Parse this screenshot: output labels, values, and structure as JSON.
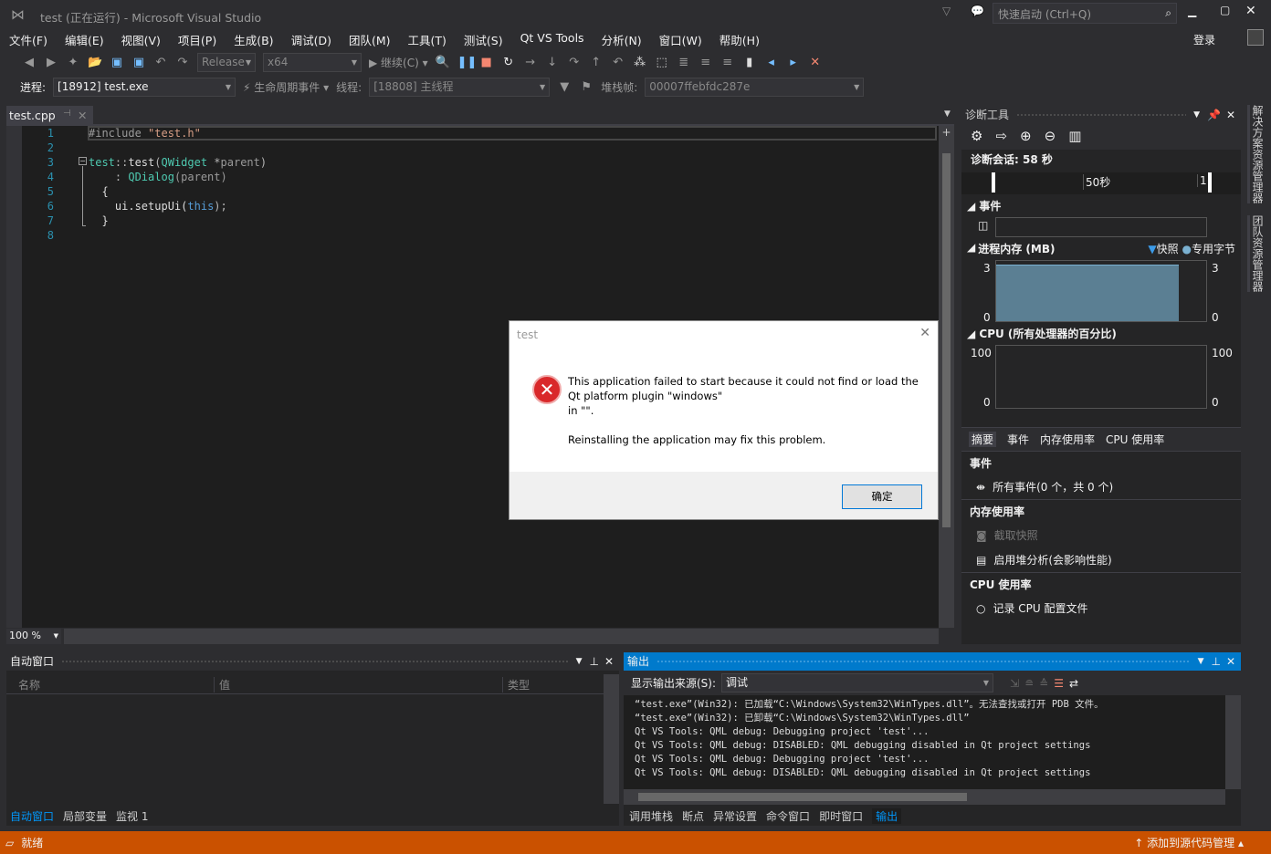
{
  "window": {
    "title": "test (正在运行) - Microsoft Visual Studio",
    "quick_launch": "快速启动 (Ctrl+Q)",
    "sign_in": "登录"
  },
  "menu": [
    "文件(F)",
    "编辑(E)",
    "视图(V)",
    "项目(P)",
    "生成(B)",
    "调试(D)",
    "团队(M)",
    "工具(T)",
    "测试(S)",
    "Qt VS Tools",
    "分析(N)",
    "窗口(W)",
    "帮助(H)"
  ],
  "toolbar": {
    "config": "Release",
    "platform": "x64",
    "continue": "继续(C)"
  },
  "debugbar": {
    "process_label": "进程:",
    "process": "[18912] test.exe",
    "lifecycle": "生命周期事件",
    "thread_label": "线程:",
    "thread": "[18808] 主线程",
    "stack_label": "堆栈帧:",
    "stack": "00007ffebfdc287e"
  },
  "editor": {
    "tab": "test.cpp",
    "zoom": "100 %",
    "line_numbers": [
      "1",
      "2",
      "3",
      "4",
      "5",
      "6",
      "7",
      "8"
    ],
    "code": {
      "l1a": "#include ",
      "l1b": "\"test.h\"",
      "l3a": "test",
      "l3b": "::",
      "l3c": "test",
      "l3d": "(",
      "l3e": "QWidget",
      "l3f": " *",
      "l3g": "parent",
      "l3h": ")",
      "l4a": ": ",
      "l4b": "QDialog",
      "l4c": "(parent)",
      "l5": "{",
      "l6a": "ui.setupUi(",
      "l6b": "this",
      "l6c": ");",
      "l7": "}"
    }
  },
  "dialog": {
    "title": "test",
    "message1": "This application failed to start because it could not find or load the Qt platform plugin \"windows\"",
    "message2": "in \"\".",
    "message3": "Reinstalling the application may fix this problem.",
    "ok": "确定"
  },
  "diag": {
    "title": "诊断工具",
    "session": "诊断会话: 58 秒",
    "ruler_mid": "50秒",
    "ruler_end": "1:",
    "events": "事件",
    "memory": "进程内存 (MB)",
    "snapshot": "快照",
    "private_bytes": "专用字节",
    "mem_max": "3",
    "mem_min": "0",
    "cpu": "CPU (所有处理器的百分比)",
    "cpu_max": "100",
    "cpu_min": "0",
    "memory_value_mb": 3,
    "tabs": [
      "摘要",
      "事件",
      "内存使用率",
      "CPU 使用率"
    ],
    "sec_events": "事件",
    "all_events": "所有事件(0 个，共 0 个)",
    "sec_mem": "内存使用率",
    "take_snapshot": "截取快照",
    "heap": "启用堆分析(会影响性能)",
    "sec_cpu": "CPU 使用率",
    "record_cpu": "记录 CPU 配置文件"
  },
  "side_tabs": [
    "解决方案资源管理器",
    "团队资源管理器"
  ],
  "autos": {
    "title": "自动窗口",
    "cols": [
      "名称",
      "值",
      "类型"
    ],
    "tabs": [
      "自动窗口",
      "局部变量",
      "监视 1"
    ]
  },
  "output": {
    "title": "输出",
    "source_label": "显示输出来源(S):",
    "source": "调试",
    "lines": [
      "“test.exe”(Win32): 已加载“C:\\Windows\\System32\\WinTypes.dll”。无法查找或打开 PDB 文件。",
      "“test.exe”(Win32): 已卸载“C:\\Windows\\System32\\WinTypes.dll”",
      "Qt VS Tools: QML debug: Debugging project 'test'...",
      "Qt VS Tools: QML debug: DISABLED: QML debugging disabled in Qt project settings",
      "Qt VS Tools: QML debug: Debugging project 'test'...",
      "Qt VS Tools: QML debug: DISABLED: QML debugging disabled in Qt project settings"
    ],
    "tabs": [
      "调用堆栈",
      "断点",
      "异常设置",
      "命令窗口",
      "即时窗口",
      "输出"
    ]
  },
  "status": {
    "text": "就绪",
    "scc": "添加到源代码管理"
  },
  "colors": {
    "accent": "#007acc",
    "status": "#ca5100",
    "bg": "#2d2d30",
    "editor": "#1e1e1e"
  }
}
